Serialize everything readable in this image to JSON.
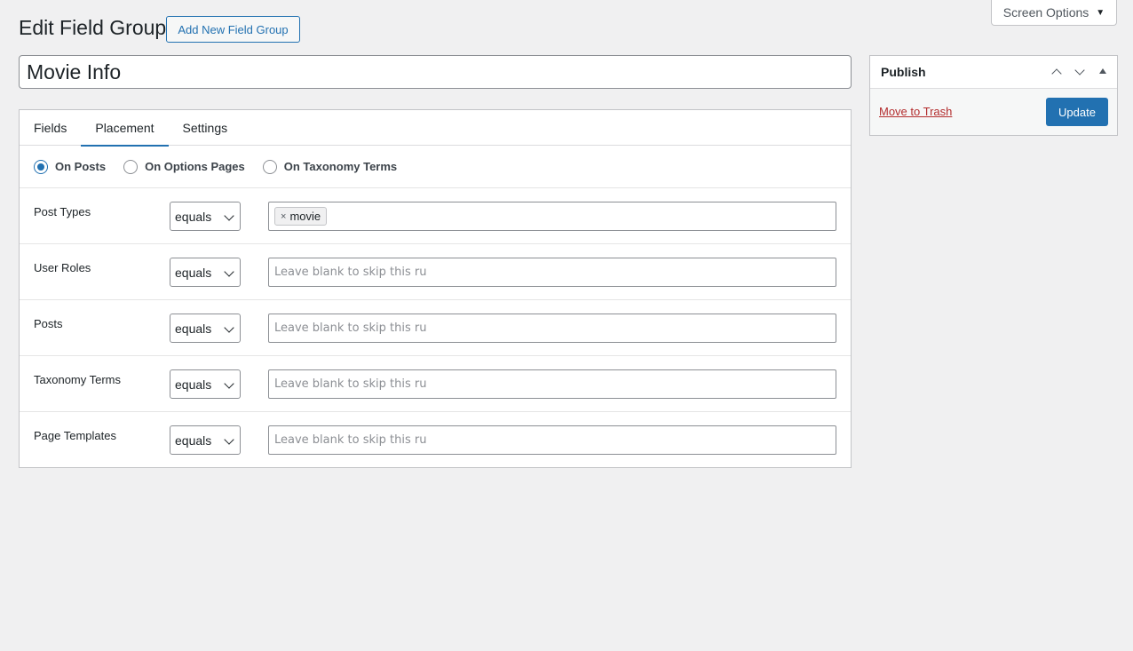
{
  "header": {
    "title": "Edit Field Group",
    "add_new_label": "Add New Field Group",
    "screen_options_label": "Screen Options"
  },
  "field_group": {
    "title_value": "Movie Info"
  },
  "tabs": [
    {
      "label": "Fields",
      "active": false
    },
    {
      "label": "Placement",
      "active": true
    },
    {
      "label": "Settings",
      "active": false
    }
  ],
  "placement": {
    "options": [
      {
        "label": "On Posts",
        "checked": true
      },
      {
        "label": "On Options Pages",
        "checked": false
      },
      {
        "label": "On Taxonomy Terms",
        "checked": false
      }
    ],
    "rules": [
      {
        "label": "Post Types",
        "operator": "equals",
        "tokens": [
          "movie"
        ],
        "placeholder": ""
      },
      {
        "label": "User Roles",
        "operator": "equals",
        "tokens": [],
        "placeholder": "Leave blank to skip this ru"
      },
      {
        "label": "Posts",
        "operator": "equals",
        "tokens": [],
        "placeholder": "Leave blank to skip this ru"
      },
      {
        "label": "Taxonomy Terms",
        "operator": "equals",
        "tokens": [],
        "placeholder": "Leave blank to skip this ru"
      },
      {
        "label": "Page Templates",
        "operator": "equals",
        "tokens": [],
        "placeholder": "Leave blank to skip this ru"
      }
    ],
    "token_remove_glyph": "×"
  },
  "publish": {
    "title": "Publish",
    "trash_label": "Move to Trash",
    "update_label": "Update"
  },
  "colors": {
    "accent": "#2271b1",
    "danger": "#b32d2e",
    "background": "#f0f0f1"
  }
}
